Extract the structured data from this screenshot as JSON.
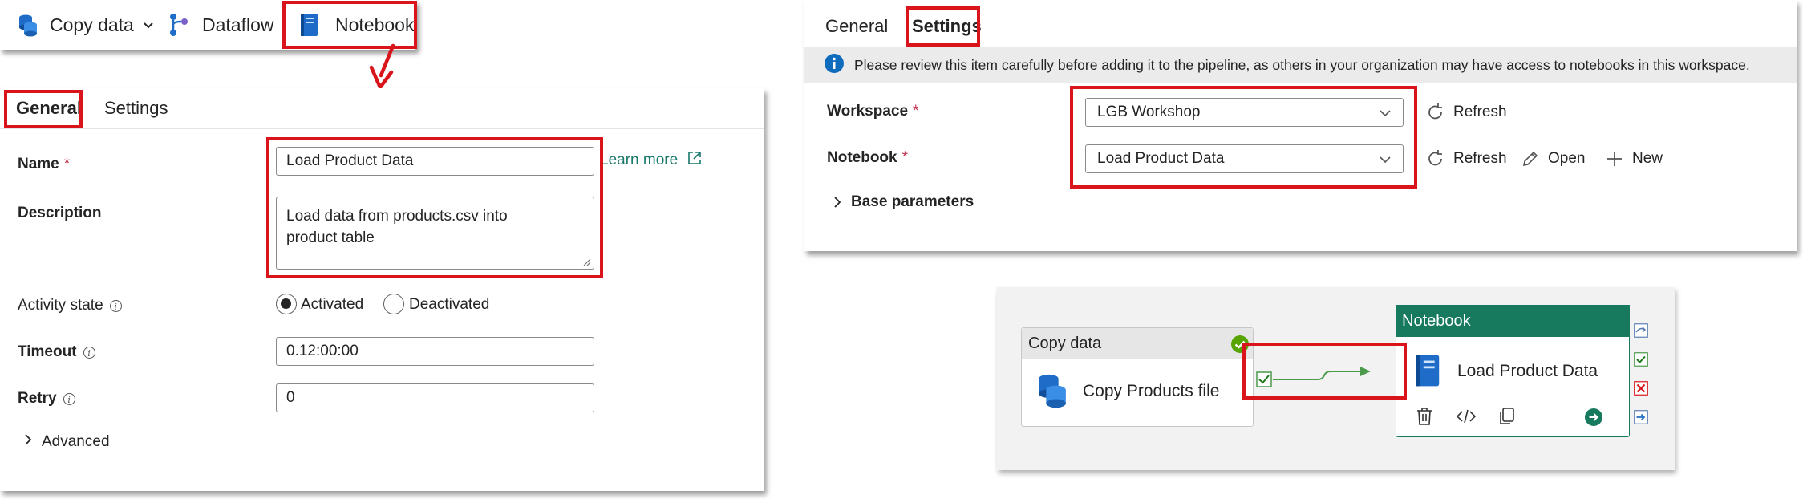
{
  "toolbar": {
    "items": [
      {
        "label": "Copy data"
      },
      {
        "label": "Dataflow"
      },
      {
        "label": "Notebook"
      }
    ]
  },
  "general_panel": {
    "tabs": [
      {
        "label": "General"
      },
      {
        "label": "Settings"
      }
    ],
    "name": {
      "label": "Name",
      "required": "*",
      "value": "Load Product Data",
      "learn_more": "Learn more"
    },
    "description": {
      "label": "Description",
      "value": "Load data from products.csv into product table"
    },
    "activity_state": {
      "label": "Activity state",
      "info": "i",
      "options": [
        "Activated",
        "Deactivated"
      ],
      "selected": "Activated"
    },
    "timeout": {
      "label": "Timeout",
      "info": "i",
      "value": "0.12:00:00"
    },
    "retry": {
      "label": "Retry",
      "info": "i",
      "value": "0"
    },
    "advanced": {
      "label": "Advanced"
    }
  },
  "settings_panel": {
    "tabs": [
      {
        "label": "General"
      },
      {
        "label": "Settings"
      }
    ],
    "banner": "Please review this item carefully before adding it to the pipeline, as others in your organization may have access to notebooks in this workspace.",
    "workspace": {
      "label": "Workspace",
      "required": "*",
      "value": "LGB Workshop",
      "refresh": "Refresh"
    },
    "notebook": {
      "label": "Notebook",
      "required": "*",
      "value": "Load Product Data",
      "refresh": "Refresh",
      "open": "Open",
      "new": "New"
    },
    "base_parameters": {
      "label": "Base parameters"
    }
  },
  "canvas": {
    "copy_node": {
      "header": "Copy data",
      "name": "Copy Products file"
    },
    "notebook_node": {
      "header": "Notebook",
      "name": "Load Product Data"
    }
  },
  "colors": {
    "highlight": "#d9141b",
    "notebook_header": "#177a5f",
    "success": "#57a300",
    "connector": "#4a9a4a",
    "failure": "#d9141b",
    "info_blue": "#0f6cbd"
  }
}
